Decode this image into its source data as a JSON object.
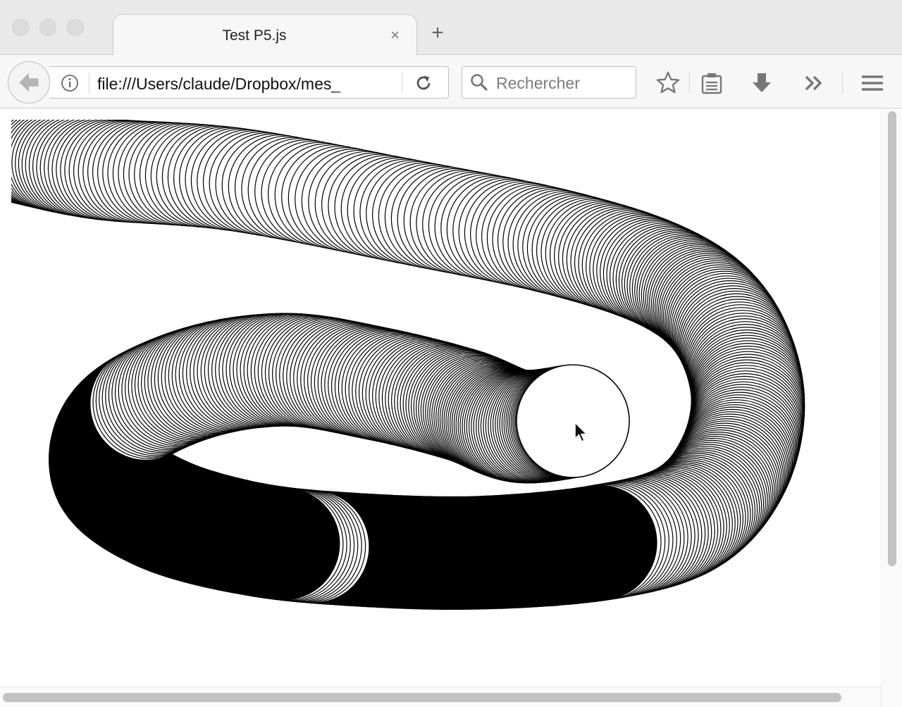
{
  "window": {
    "tab_title": "Test P5.js",
    "tab_close": "×",
    "new_tab": "+"
  },
  "navbar": {
    "url": "file:///Users/claude/Dropbox/mes_",
    "search_placeholder": "Rechercher"
  },
  "icons": {
    "back": "arrow-left-icon",
    "info": "info-icon",
    "reload": "reload-icon",
    "search": "search-icon",
    "bookmark": "star-icon",
    "reading_list": "clipboard-icon",
    "downloads": "download-arrow-icon",
    "overflow": "double-chevron-icon",
    "menu": "hamburger-icon"
  },
  "colors": {
    "stroke": "#000000",
    "fill": "#ffffff",
    "toolbar_icon": "#7a7a7a"
  }
}
